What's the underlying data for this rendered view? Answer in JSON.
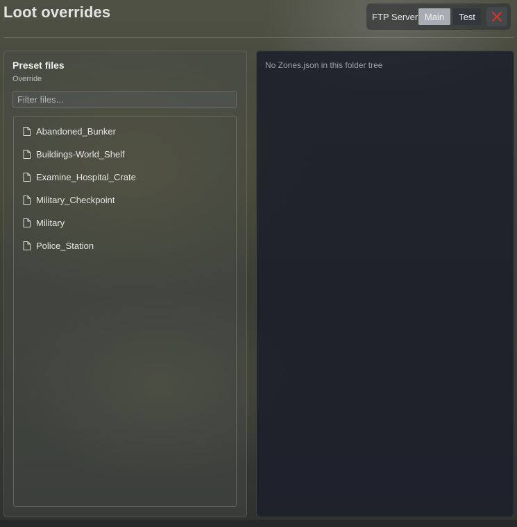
{
  "window": {
    "title": "Loot overrides"
  },
  "server": {
    "label": "FTP Server",
    "options": [
      "Main",
      "Test"
    ],
    "selected": "Main"
  },
  "close_icon": "close-x-icon",
  "colors": {
    "close_accent": "#c0392b",
    "selected_button": "#a9adb3"
  },
  "preset": {
    "title": "Preset files",
    "subtitle": "Override",
    "filter_placeholder": "Filter files...",
    "files": [
      "Abandoned_Bunker",
      "Buildings-World_Shelf",
      "Examine_Hospital_Crate",
      "Military_Checkpoint",
      "Military",
      "Police_Station"
    ],
    "file_icon": "file-icon"
  },
  "zones": {
    "message": "No Zones.json in this folder tree"
  }
}
